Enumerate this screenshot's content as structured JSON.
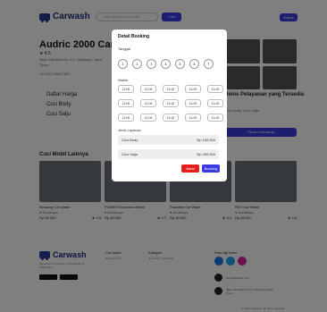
{
  "navbar": {
    "brand": "Carwash",
    "search_placeholder": "Cari tempat cuci mobil",
    "search_button": "Cari",
    "login_button": "Masuk"
  },
  "shop": {
    "title": "Audric 2000 Car Wash",
    "rating": "4.5",
    "address": "Jalan Merdeka No. 10, Surabaya, Jawa Timur",
    "phone": "+62 812 3456 7890"
  },
  "price_list": {
    "title": "Daftar Harga",
    "items": [
      "Cuci Body",
      "Cuci Salju"
    ]
  },
  "layanan": {
    "title": "Jenis Pelayanan yang Tersedia",
    "subtitle": "Cuci Body, Cuci Salju",
    "button": "Pesan Sekarang"
  },
  "other": {
    "title": "Cuci Mobil Lainnya",
    "cards": [
      {
        "name": "Kinclong Car Wash",
        "loc": "Surabaya",
        "price": "Rp 35.000",
        "rating": "4.5"
      },
      {
        "name": "POWER Autoclean Wash",
        "loc": "Surabaya",
        "price": "Rp 40.000",
        "rating": "4.7"
      },
      {
        "name": "Paradise Car Wash",
        "loc": "Surabaya",
        "price": "Rp 30.000",
        "rating": "4.2"
      },
      {
        "name": "REX Car Wash",
        "loc": "Surabaya",
        "price": "Rp 45.000",
        "rating": "4.8"
      }
    ]
  },
  "footer": {
    "brand": "Carwash",
    "desc": "Temukan tempat cuci mobil terbaik di dekat kamu",
    "col1_title": "Car Wash",
    "col1_sub": "Booking Cuci",
    "col2_title": "Kategori",
    "col2_sub": "Cuci Body, Cuci Salju",
    "col3_title": "Hubungi Kami",
    "email": "info@carwash.com",
    "address": "Jalan Merdeka No. 10, Surabaya, Jawa Timur",
    "copyright": "© 2023 Carwash. All rights reserved."
  },
  "modal": {
    "title": "Detail Booking",
    "date_label": "Tanggal",
    "dates": [
      "1",
      "2",
      "3",
      "4",
      "5",
      "6",
      "7"
    ],
    "time_label": "Waktu",
    "times": [
      "13.00",
      "13.00",
      "13.00",
      "13.00",
      "13.00",
      "13.00",
      "13.00",
      "13.00",
      "13.00",
      "13.00",
      "13.00",
      "13.00",
      "13.00",
      "13.00",
      "13.00"
    ],
    "service_label": "Jenis Layanan",
    "services": [
      {
        "name": "Cuci Body",
        "price": "Rp 150.000"
      },
      {
        "name": "Cuci Salju",
        "price": "Rp 250.000"
      }
    ],
    "cancel": "Batal",
    "book": "Booking"
  },
  "colors": {
    "primary": "#3b3ce0",
    "danger": "#e51d1d",
    "brand": "#1b2a7a"
  }
}
